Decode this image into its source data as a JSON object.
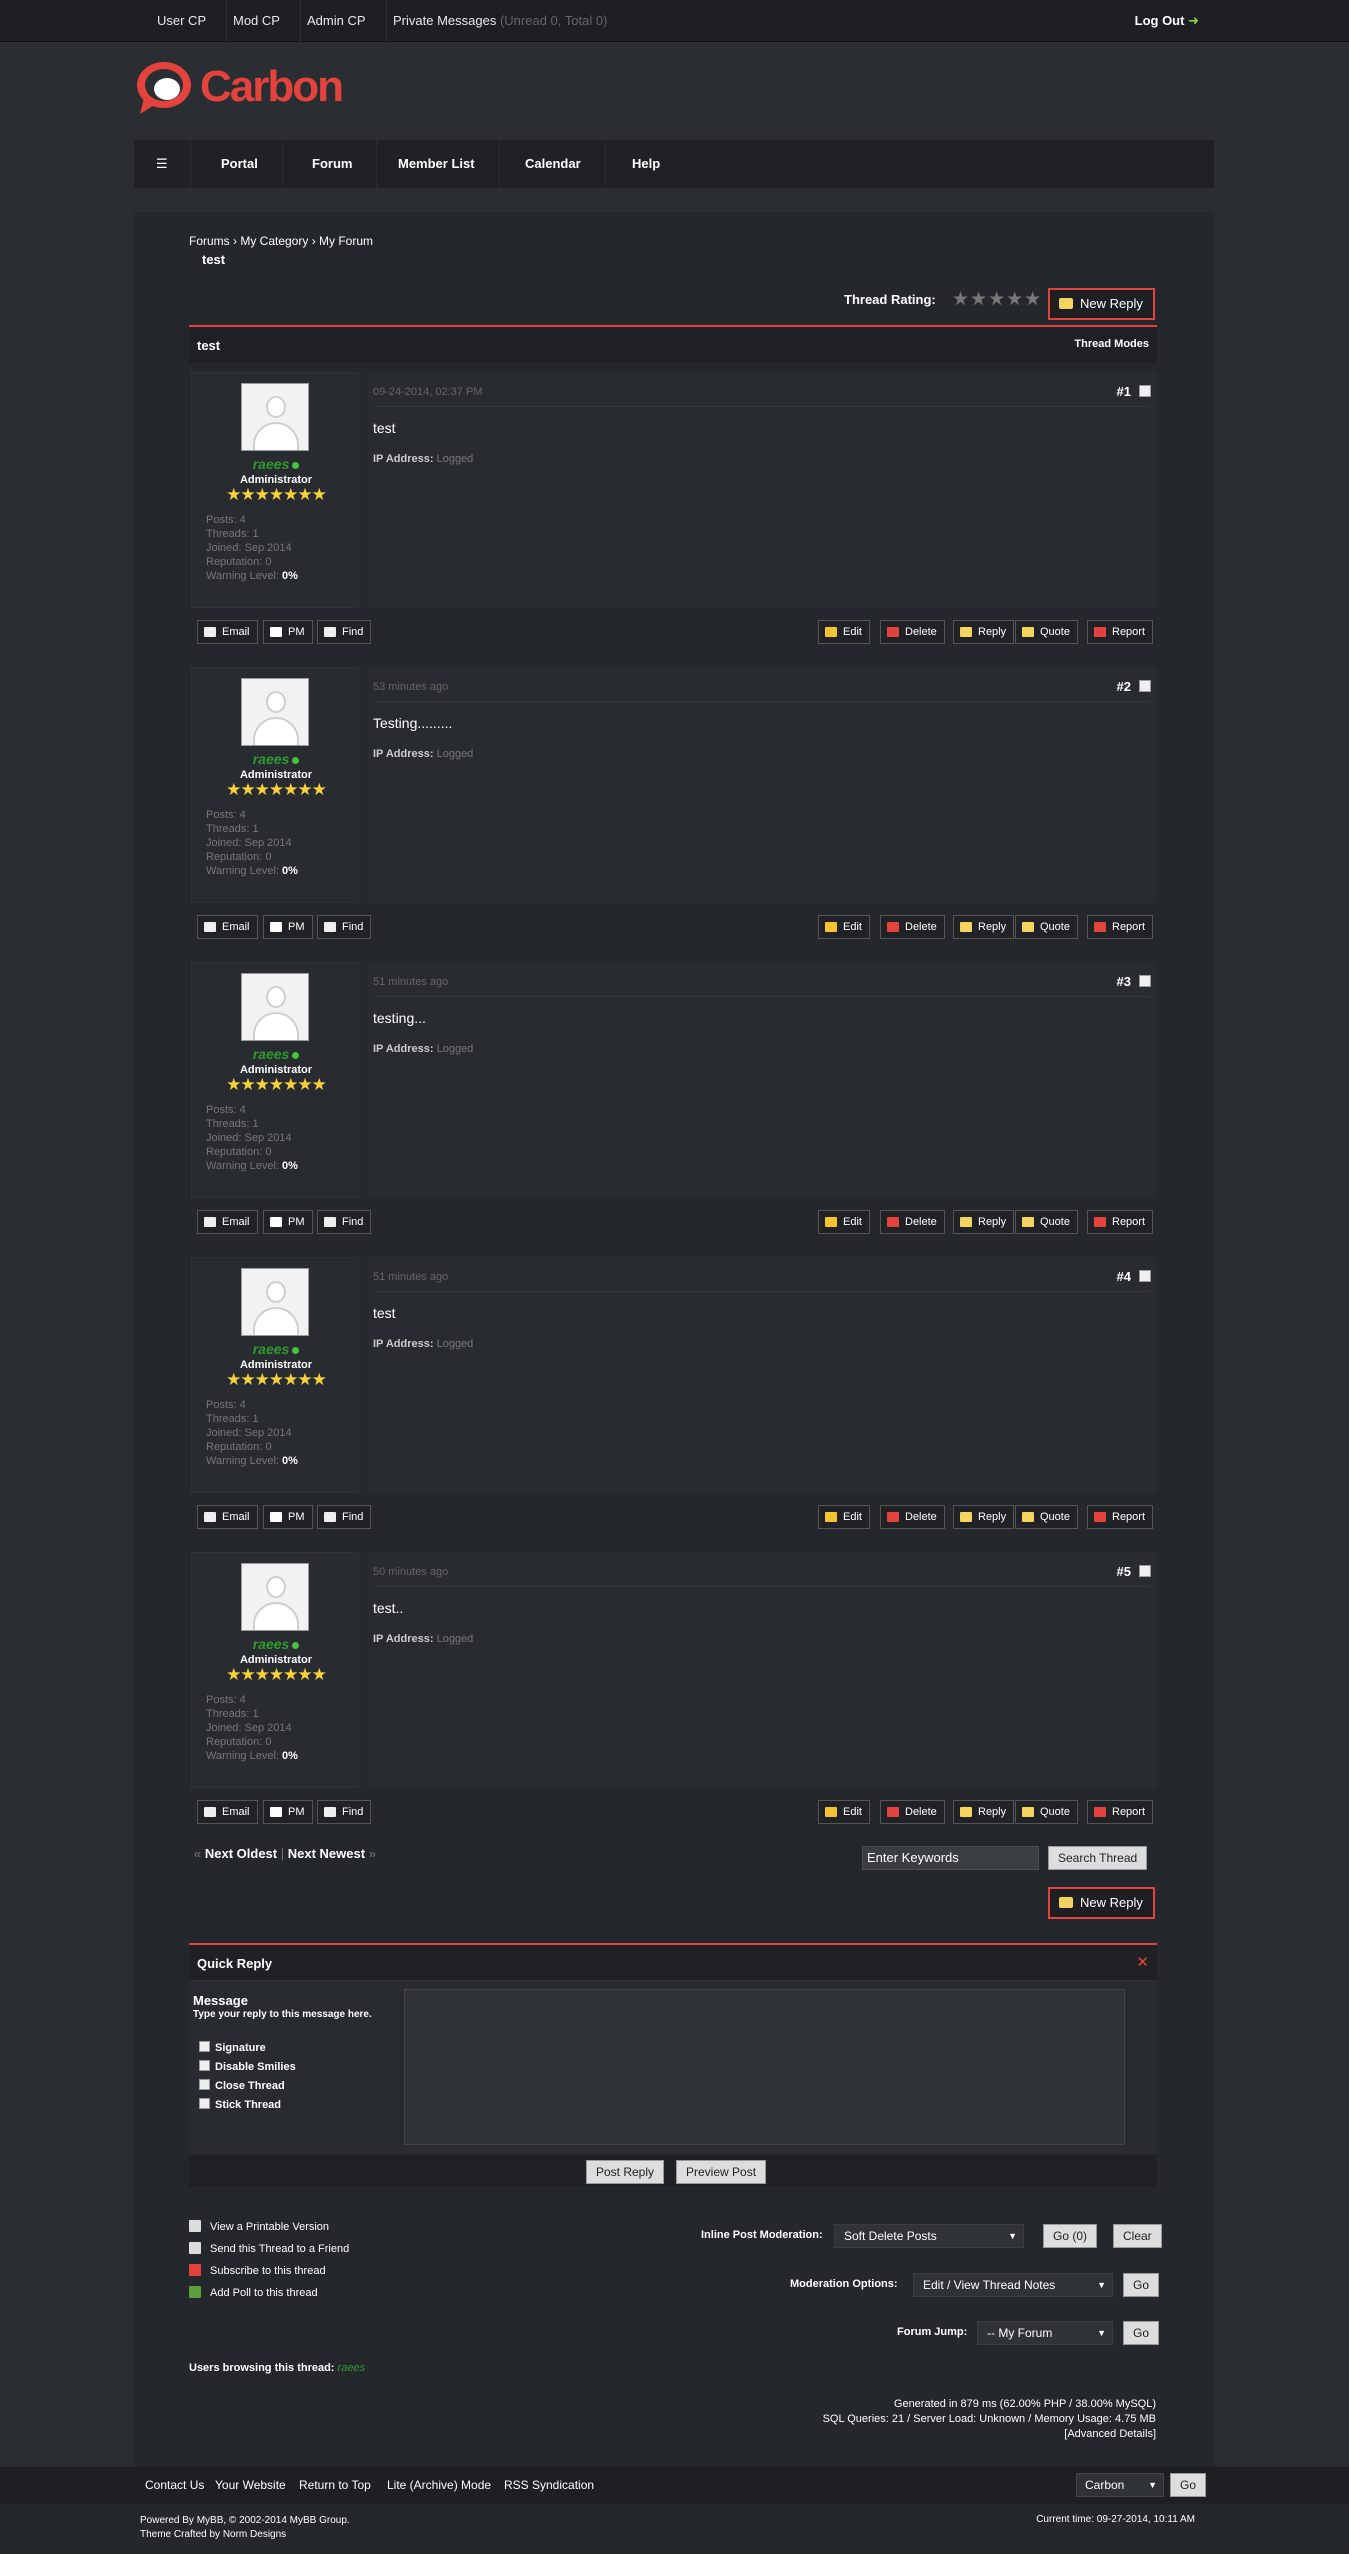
{
  "topbar": {
    "links": [
      "User CP",
      "Mod CP",
      "Admin CP",
      "Private Messages"
    ],
    "pm_count": "(Unread 0, Total 0)",
    "logout": "Log Out"
  },
  "logo": {
    "text": "Carbon"
  },
  "nav": [
    "Portal",
    "Forum",
    "Member List",
    "Calendar",
    "Help"
  ],
  "breadcrumb": {
    "path": "Forums › My Category › My Forum",
    "current": "test"
  },
  "thread": {
    "rating_label": "Thread Rating:",
    "new_reply": "New Reply",
    "title": "test",
    "modes": "Thread Modes"
  },
  "posts": [
    {
      "date": "09-24-2014, 02:37 PM",
      "num": "#1",
      "text": "test"
    },
    {
      "date": "53 minutes ago",
      "num": "#2",
      "text": "Testing........."
    },
    {
      "date": "51 minutes ago",
      "num": "#3",
      "text": "testing..."
    },
    {
      "date": "51 minutes ago",
      "num": "#4",
      "text": "test"
    },
    {
      "date": "50 minutes ago",
      "num": "#5",
      "text": "test.."
    }
  ],
  "author": {
    "name": "raees",
    "role": "Administrator",
    "stars": "★★★★★★★",
    "posts": "Posts: 4",
    "threads": "Threads: 1",
    "joined": "Joined: Sep 2014",
    "reputation": "Reputation: 0",
    "warning_label": "Warning Level:",
    "warning": "0%",
    "ip_label": "IP Address:",
    "ip": "Logged"
  },
  "post_buttons": {
    "email": "Email",
    "pm": "PM",
    "find": "Find",
    "edit": "Edit",
    "delete": "Delete",
    "reply": "Reply",
    "quote": "Quote",
    "report": "Report"
  },
  "thread_nav": {
    "prev_arrow": "«",
    "prev": "Next Oldest",
    "sep": "|",
    "next": "Next Newest",
    "next_arrow": "»",
    "keywords": "Enter Keywords",
    "search": "Search Thread"
  },
  "quick_reply": {
    "title": "Quick Reply",
    "message": "Message",
    "hint": "Type your reply to this message here.",
    "options": [
      "Signature",
      "Disable Smilies",
      "Close Thread",
      "Stick Thread"
    ],
    "post": "Post Reply",
    "preview": "Preview Post"
  },
  "thread_options": [
    "View a Printable Version",
    "Send this Thread to a Friend",
    "Subscribe to this thread",
    "Add Poll to this thread"
  ],
  "moderation": {
    "inline_label": "Inline Post Moderation:",
    "inline_value": "Soft Delete Posts",
    "go_count": "Go (0)",
    "clear": "Clear",
    "options_label": "Moderation Options:",
    "options_value": "Edit / View Thread Notes",
    "go": "Go",
    "jump_label": "Forum Jump:",
    "jump_value": "-- My Forum"
  },
  "browsing": {
    "label": "Users browsing this thread:",
    "users": "raees"
  },
  "stats": {
    "line1": "Generated in 879 ms (62.00% PHP / 38.00% MySQL)",
    "line2": "SQL Queries: 21 / Server Load: Unknown / Memory Usage: 4.75 MB",
    "line3": "[Advanced Details]"
  },
  "footer": {
    "links": [
      "Contact Us",
      "Your Website",
      "Return to Top",
      "Lite (Archive) Mode",
      "RSS Syndication"
    ],
    "theme": "Carbon",
    "go": "Go",
    "powered": "Powered By MyBB, © 2002-2014 MyBB Group.",
    "crafted": "Theme Crafted by Norm Designs",
    "time": "Current time: 09-27-2014, 10:11 AM"
  },
  "colors": {
    "accent": "#e3433c",
    "bg": "#2a2d31",
    "online": "#44c33c"
  }
}
